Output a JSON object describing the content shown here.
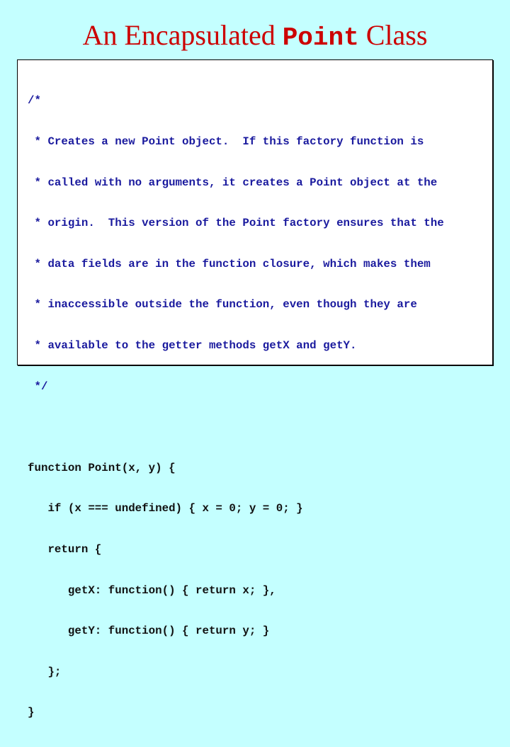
{
  "slide": {
    "title_prefix": "An Encapsulated ",
    "title_code": "Point",
    "title_suffix": " Class",
    "colors": {
      "background": "#c4ffff",
      "title": "#cc0000",
      "comment": "#1a1a9e",
      "code": "#111111"
    }
  },
  "code": {
    "comment_lines": [
      "/*",
      " * Creates a new Point object.  If this factory function is",
      " * called with no arguments, it creates a Point object at the",
      " * origin.  This version of the Point factory ensures that the",
      " * data fields are in the function closure, which makes them",
      " * inaccessible outside the function, even though they are",
      " * available to the getter methods getX and getY.",
      " */"
    ],
    "code_lines": [
      "function Point(x, y) {",
      "   if (x === undefined) { x = 0; y = 0; }",
      "   return {",
      "      getX: function() { return x; },",
      "      getY: function() { return y; }",
      "   };",
      "}"
    ]
  }
}
